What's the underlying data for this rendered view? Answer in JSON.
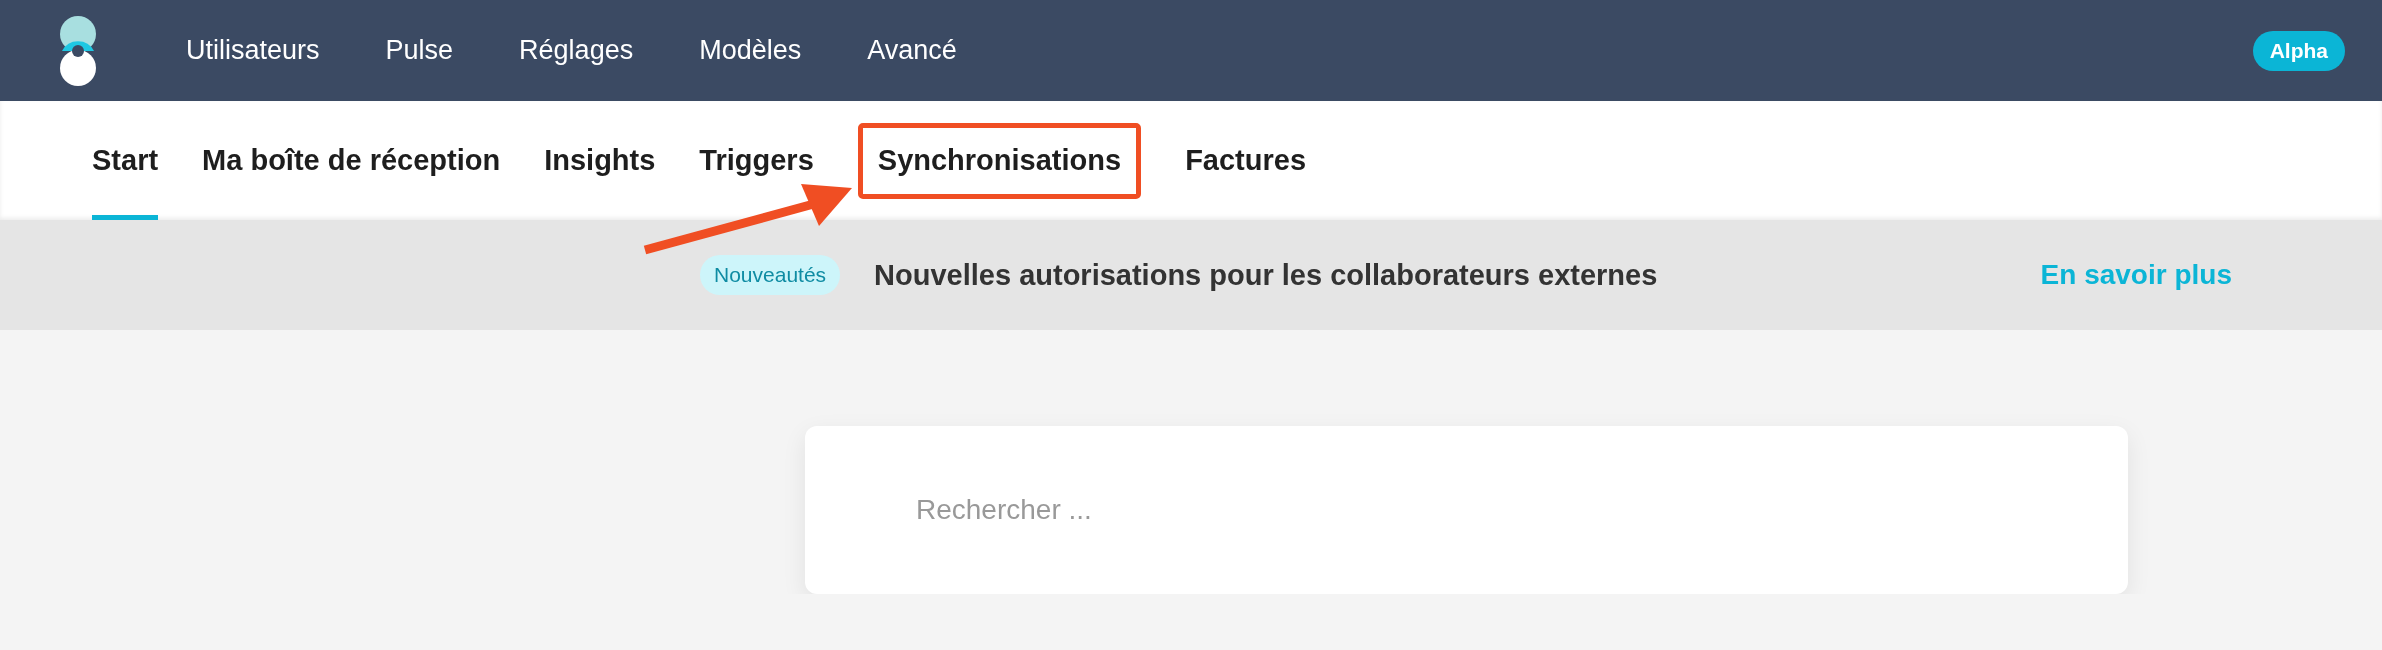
{
  "header": {
    "nav": [
      {
        "label": "Utilisateurs"
      },
      {
        "label": "Pulse"
      },
      {
        "label": "Réglages"
      },
      {
        "label": "Modèles"
      },
      {
        "label": "Avancé"
      }
    ],
    "badge": "Alpha"
  },
  "tabs": [
    {
      "label": "Start",
      "selected": true,
      "highlighted": false
    },
    {
      "label": "Ma boîte de réception",
      "selected": false,
      "highlighted": false
    },
    {
      "label": "Insights",
      "selected": false,
      "highlighted": false
    },
    {
      "label": "Triggers",
      "selected": false,
      "highlighted": false
    },
    {
      "label": "Synchronisations",
      "selected": false,
      "highlighted": true
    },
    {
      "label": "Factures",
      "selected": false,
      "highlighted": false
    }
  ],
  "banner": {
    "tag": "Nouveautés",
    "message": "Nouvelles autorisations pour les collaborateurs externes",
    "link": "En savoir plus"
  },
  "search": {
    "placeholder": "Rechercher ..."
  }
}
